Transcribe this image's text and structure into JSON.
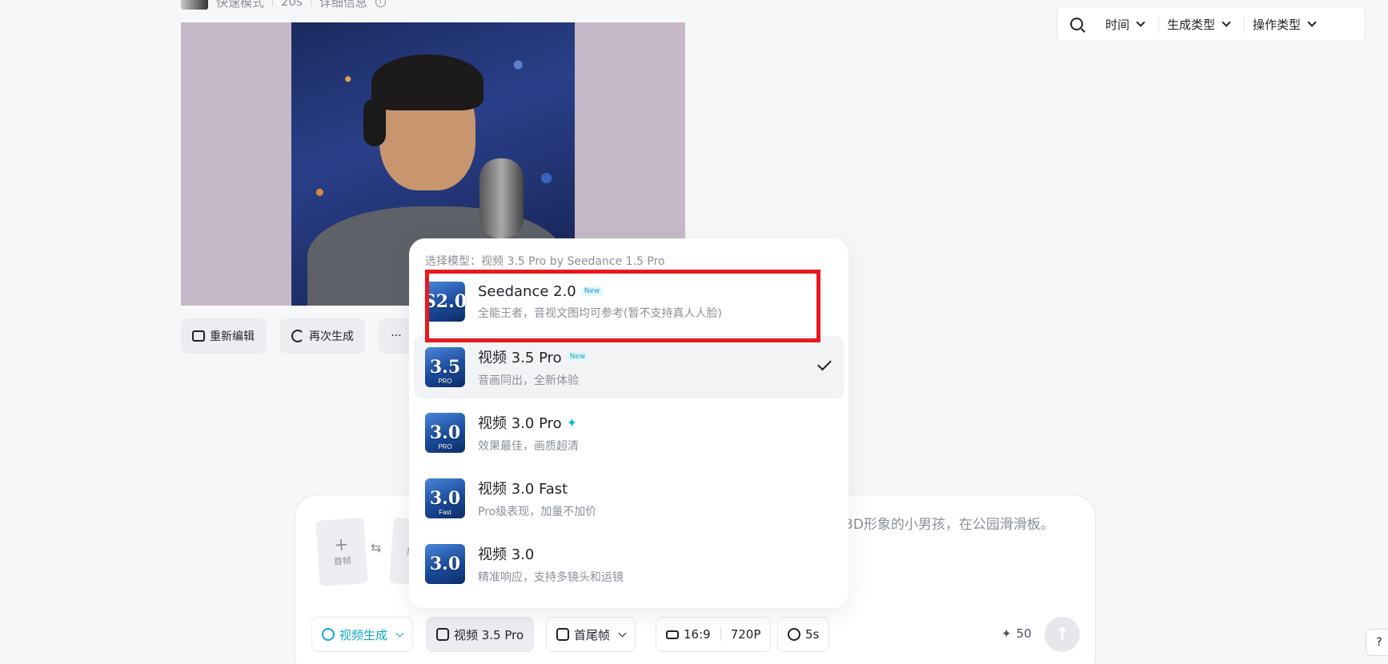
{
  "meta": {
    "mode": "快速模式",
    "duration": "20s",
    "detail": "详细信息"
  },
  "actions": {
    "re_edit": "重新编辑",
    "regenerate": "再次生成",
    "more": "···"
  },
  "filters": {
    "time": "时间",
    "gen_type": "生成类型",
    "op_type": "操作类型"
  },
  "composer": {
    "first_frame": "首帧",
    "last_frame": "尾帧",
    "prompt": "3D形象的小男孩，在公园滑滑板。",
    "mode_button": "视频生成",
    "model_button": "视频 3.5 Pro",
    "frames_button": "首尾帧",
    "ratio": "16:9",
    "resolution": "720P",
    "duration": "5s",
    "credits": "50"
  },
  "dropdown": {
    "header": "选择模型：视频 3.5 Pro by Seedance 1.5 Pro",
    "items": [
      {
        "thumb": "S2.0",
        "thumb_sub": "",
        "title": "Seedance 2.0",
        "badge": "New",
        "desc": "全能王者，音视文图均可参考(暂不支持真人人脸)"
      },
      {
        "thumb": "3.5",
        "thumb_sub": "PRO",
        "title": "视频 3.5 Pro",
        "badge": "New",
        "desc": "音画同出，全新体验",
        "selected": true
      },
      {
        "thumb": "3.0",
        "thumb_sub": "PRO",
        "title": "视频 3.0 Pro",
        "badge": "",
        "desc": "效果最佳，画质超清",
        "sparkle": true
      },
      {
        "thumb": "3.0",
        "thumb_sub": "Fast",
        "title": "视频 3.0 Fast",
        "badge": "",
        "desc": "Pro级表现，加量不加价"
      },
      {
        "thumb": "3.0",
        "thumb_sub": "",
        "title": "视频 3.0",
        "badge": "",
        "desc": "精准响应，支持多镜头和运镜"
      }
    ]
  },
  "colors": {
    "accent": "#14a7c8",
    "highlight": "#e8191f"
  }
}
